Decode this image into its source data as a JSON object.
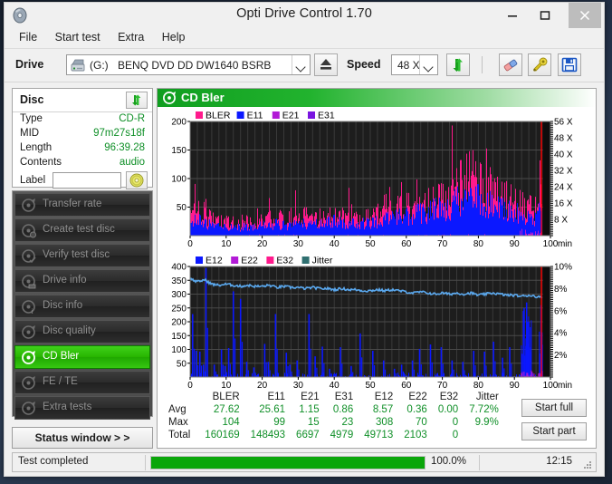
{
  "window": {
    "title": "Opti Drive Control 1.70",
    "icon": "disc-icon",
    "minimize": "minimize-icon",
    "maximize": "maximize-icon",
    "close": "close-icon"
  },
  "menu": {
    "items": [
      {
        "label": "File"
      },
      {
        "label": "Start test"
      },
      {
        "label": "Extra"
      },
      {
        "label": "Help"
      }
    ]
  },
  "toolbar": {
    "drive_label": "Drive",
    "drive_icon": "drive-icon",
    "drive_letter": "(G:)",
    "drive_name": "BENQ DVD DD DW1640 BSRB",
    "eject_icon": "eject-icon",
    "speed_label": "Speed",
    "speed_value": "48 X",
    "refresh_icon": "refresh-arrows-icon",
    "erase_icon": "erase-icon",
    "tools_icon": "tools-icon",
    "save_icon": "save-floppy-icon"
  },
  "disc_panel": {
    "title": "Disc",
    "refresh_icon": "refresh-arrows-icon",
    "rows": [
      {
        "key": "Type",
        "value": "CD-R"
      },
      {
        "key": "MID",
        "value": "97m27s18f"
      },
      {
        "key": "Length",
        "value": "96:39.28"
      },
      {
        "key": "Contents",
        "value": "audio"
      }
    ],
    "label_key": "Label",
    "label_value": "",
    "label_placeholder": "",
    "label_button_icon": "cd-disc-icon"
  },
  "nav": {
    "items": [
      {
        "label": "Transfer rate",
        "icon": "disc-test-icon",
        "active": false
      },
      {
        "label": "Create test disc",
        "icon": "disc-burn-icon",
        "active": false
      },
      {
        "label": "Verify test disc",
        "icon": "disc-verify-icon",
        "active": false
      },
      {
        "label": "Drive info",
        "icon": "disc-drive-icon",
        "active": false
      },
      {
        "label": "Disc info",
        "icon": "disc-info-icon",
        "active": false
      },
      {
        "label": "Disc quality",
        "icon": "disc-quality-icon",
        "active": false
      },
      {
        "label": "CD Bler",
        "icon": "disc-bler-icon",
        "active": true
      },
      {
        "label": "FE / TE",
        "icon": "disc-fete-icon",
        "active": false
      },
      {
        "label": "Extra tests",
        "icon": "disc-extra-icon",
        "active": false
      }
    ],
    "status_window_label": "Status window > >"
  },
  "panel": {
    "header_title": "CD Bler",
    "header_icon": "disc-bler-icon"
  },
  "actions": {
    "start_full": "Start full",
    "start_part": "Start part"
  },
  "stats": {
    "columns": [
      "BLER",
      "E11",
      "E21",
      "E31",
      "E12",
      "E22",
      "E32",
      "Jitter"
    ],
    "rows": [
      {
        "label": "Avg",
        "values": [
          "27.62",
          "25.61",
          "1.15",
          "0.86",
          "8.57",
          "0.36",
          "0.00",
          "7.72%"
        ]
      },
      {
        "label": "Max",
        "values": [
          "104",
          "99",
          "15",
          "23",
          "308",
          "70",
          "0",
          "9.9%"
        ]
      },
      {
        "label": "Total",
        "values": [
          "160169",
          "148493",
          "6697",
          "4979",
          "49713",
          "2103",
          "0",
          ""
        ]
      }
    ]
  },
  "statusbar": {
    "text": "Test completed",
    "progress_percent": "100.0%",
    "progress_value": 100,
    "time": "12:15",
    "grip_icon": "resize-grip-icon"
  },
  "colors": {
    "bler": "#ff1a8c",
    "e11": "#0b18ff",
    "e21": "#b21ad6",
    "e31": "#7a16e0",
    "e12": "#0b18ff",
    "e22": "#b21ad6",
    "e32": "#ff1a8c",
    "jitter": "#2f6f70",
    "jitter_line": "#5aa8ee",
    "accent_green": "#22b32e",
    "value_green": "#0f8f27",
    "plot_bg": "#1d1d1d",
    "marker_red": "#ff0000"
  },
  "chart_data": [
    {
      "type": "area",
      "id": "cd-bler-chart",
      "title": "CD Bler",
      "xlabel": "min",
      "ylabel": "",
      "xlim": [
        0,
        100
      ],
      "ylim": [
        0,
        200
      ],
      "xticks": [
        0,
        10,
        20,
        30,
        40,
        50,
        60,
        70,
        80,
        90,
        100
      ],
      "yticks": [
        50,
        100,
        150,
        200
      ],
      "y2ticks": [
        "8 X",
        "16 X",
        "24 X",
        "32 X",
        "40 X",
        "48 X",
        "56 X"
      ],
      "y2lim": [
        0,
        56
      ],
      "y2label": "X",
      "grid": true,
      "legend": [
        {
          "name": "BLER",
          "color": "#ff1a8c"
        },
        {
          "name": "E11",
          "color": "#0b18ff"
        },
        {
          "name": "E21",
          "color": "#b21ad6"
        },
        {
          "name": "E31",
          "color": "#7a16e0"
        }
      ],
      "legend_position": "top-left",
      "marker_x": 97.5,
      "series": [
        {
          "name": "BLER",
          "color": "#ff1a8c",
          "x": [
            0,
            2,
            4,
            6,
            8,
            10,
            12,
            14,
            16,
            18,
            20,
            22,
            24,
            26,
            28,
            30,
            32,
            34,
            36,
            38,
            40,
            42,
            44,
            46,
            48,
            50,
            52,
            54,
            56,
            58,
            60,
            62,
            64,
            66,
            68,
            70,
            72,
            74,
            76,
            78,
            80,
            82,
            84,
            86,
            88,
            90,
            92,
            94,
            96,
            97
          ],
          "values": [
            32,
            38,
            30,
            27,
            24,
            22,
            21,
            20,
            22,
            20,
            24,
            26,
            28,
            25,
            26,
            28,
            30,
            29,
            27,
            30,
            33,
            30,
            28,
            27,
            29,
            31,
            33,
            36,
            40,
            44,
            47,
            50,
            53,
            55,
            58,
            62,
            68,
            76,
            86,
            96,
            82,
            74,
            66,
            60,
            58,
            52,
            48,
            44,
            40,
            55
          ]
        },
        {
          "name": "E11",
          "color": "#0b18ff",
          "x": [
            0,
            2,
            4,
            6,
            8,
            10,
            12,
            14,
            16,
            18,
            20,
            22,
            24,
            26,
            28,
            30,
            32,
            34,
            36,
            38,
            40,
            42,
            44,
            46,
            48,
            50,
            52,
            54,
            56,
            58,
            60,
            62,
            64,
            66,
            68,
            70,
            72,
            74,
            76,
            78,
            80,
            82,
            84,
            86,
            88,
            90,
            92,
            94,
            96,
            97
          ],
          "values": [
            28,
            34,
            27,
            24,
            21,
            19,
            18,
            17,
            19,
            18,
            21,
            23,
            25,
            22,
            23,
            25,
            27,
            26,
            24,
            27,
            30,
            27,
            25,
            24,
            26,
            28,
            30,
            33,
            36,
            40,
            43,
            46,
            49,
            51,
            54,
            58,
            63,
            70,
            79,
            88,
            75,
            68,
            61,
            55,
            53,
            48,
            44,
            40,
            36,
            50
          ]
        },
        {
          "name": "E21",
          "color": "#b21ad6",
          "x": [
            0,
            10,
            20,
            30,
            40,
            50,
            60,
            70,
            80,
            90,
            92,
            94,
            96
          ],
          "values": [
            1,
            1,
            1,
            1,
            1,
            1,
            1,
            1,
            2,
            2,
            6,
            5,
            4
          ]
        },
        {
          "name": "E31",
          "color": "#7a16e0",
          "x": [
            0,
            10,
            20,
            30,
            40,
            50,
            60,
            70,
            80,
            90,
            92,
            94,
            96
          ],
          "values": [
            1,
            1,
            1,
            1,
            1,
            1,
            1,
            1,
            1,
            1,
            4,
            3,
            3
          ]
        },
        {
          "name": "Speed",
          "color": "#ff0000",
          "x": [],
          "values": []
        }
      ]
    },
    {
      "type": "line",
      "id": "cd-bler-e12-chart",
      "title": "",
      "xlabel": "min",
      "ylabel": "",
      "xlim": [
        0,
        100
      ],
      "ylim": [
        0,
        400
      ],
      "xticks": [
        0,
        10,
        20,
        30,
        40,
        50,
        60,
        70,
        80,
        90,
        100
      ],
      "yticks": [
        50,
        100,
        150,
        200,
        250,
        300,
        350,
        400
      ],
      "y2ticks": [
        "2%",
        "4%",
        "6%",
        "8%",
        "10%"
      ],
      "y2lim": [
        0,
        10
      ],
      "grid": true,
      "legend": [
        {
          "name": "E12",
          "color": "#0b18ff"
        },
        {
          "name": "E22",
          "color": "#b21ad6"
        },
        {
          "name": "E32",
          "color": "#ff1a8c"
        },
        {
          "name": "Jitter",
          "color": "#2f6f70"
        }
      ],
      "legend_position": "top-left",
      "marker_x": 97.5,
      "series": [
        {
          "name": "Jitter",
          "color": "#5aa8ee",
          "unit": "%",
          "x": [
            0,
            2,
            4,
            6,
            8,
            10,
            12,
            14,
            16,
            18,
            20,
            22,
            24,
            26,
            28,
            30,
            32,
            34,
            36,
            38,
            40,
            42,
            44,
            46,
            48,
            50,
            52,
            54,
            56,
            58,
            60,
            62,
            64,
            66,
            68,
            70,
            72,
            74,
            76,
            78,
            80,
            82,
            84,
            86,
            88,
            90,
            92,
            94,
            96,
            97
          ],
          "values": [
            8.9,
            8.6,
            8.8,
            8.4,
            8.3,
            8.4,
            8.3,
            8.2,
            8.3,
            8.2,
            8.2,
            8.3,
            8.1,
            8.2,
            8.1,
            8.1,
            8.0,
            8.1,
            8.0,
            8.0,
            7.9,
            8.0,
            7.9,
            7.9,
            7.8,
            7.8,
            7.9,
            7.8,
            7.9,
            7.8,
            7.7,
            7.6,
            7.7,
            7.6,
            7.5,
            7.6,
            7.5,
            7.6,
            7.5,
            7.6,
            7.4,
            7.5,
            7.6,
            7.5,
            7.4,
            7.4,
            7.3,
            7.4,
            7.3,
            7.2
          ]
        },
        {
          "name": "E12",
          "color": "#0b18ff",
          "x": [
            0.5,
            1.5,
            2.5,
            3.5,
            4.2,
            6.5,
            8.5,
            9.5,
            10.5,
            11.8,
            13.8,
            15.5,
            17.5,
            20.5,
            21.5,
            23.5,
            26.5,
            27.5,
            29.5,
            32.8,
            34.5,
            36.5,
            38.5,
            41.5,
            44.5,
            47.0,
            50.5,
            53.5,
            56.5,
            58.5,
            61.5,
            63.5,
            66.5,
            69.5,
            72.5,
            75.5,
            78.5,
            81.5,
            84.0,
            86.5,
            88.5,
            92.5,
            93.2,
            93.8,
            97.2
          ],
          "values": [
            228,
            95,
            92,
            45,
            395,
            45,
            100,
            40,
            105,
            310,
            283,
            55,
            35,
            120,
            55,
            228,
            88,
            45,
            60,
            228,
            75,
            110,
            30,
            108,
            40,
            158,
            95,
            60,
            30,
            45,
            60,
            102,
            118,
            108,
            60,
            55,
            95,
            92,
            128,
            70,
            108,
            250,
            270,
            200,
            260
          ]
        },
        {
          "name": "E22",
          "color": "#b21ad6",
          "x": [
            92.5,
            93.5,
            94.5,
            97.5
          ],
          "values": [
            22,
            25,
            12,
            18
          ]
        },
        {
          "name": "E32",
          "color": "#ff1a8c",
          "x": [],
          "values": []
        }
      ]
    }
  ]
}
